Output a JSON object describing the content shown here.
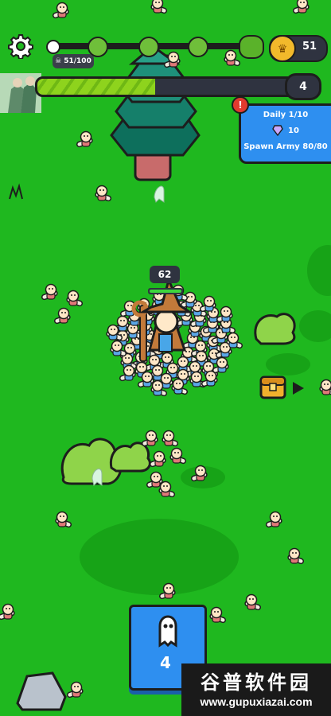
{
  "hud": {
    "settings_icon": "gear-icon",
    "kill_counter": "51/100",
    "skull_icon": "skull-icon",
    "coins": "51",
    "crown_icon": "crown-icon",
    "level": "4",
    "xp_fraction": 0.46,
    "wave_progress_fraction": 0.0
  },
  "daily": {
    "title": "Daily 1/10",
    "reward": "10",
    "gem_icon": "diamond-icon",
    "task": "Spawn Army 80/80",
    "alert": "!"
  },
  "army": {
    "count": "62"
  },
  "spawn_card": {
    "icon": "ghost-icon",
    "value": "4"
  },
  "watermark": {
    "title": "谷普软件园",
    "url": "www.gupuxiazai.com"
  },
  "colors": {
    "grass": "#1fb81f",
    "dark_grass": "#17a317",
    "panel_blue": "#2e8ff0",
    "xp_green": "#8ed31d",
    "coin_gold": "#f2b92b",
    "hud_dark": "#2f3340"
  }
}
